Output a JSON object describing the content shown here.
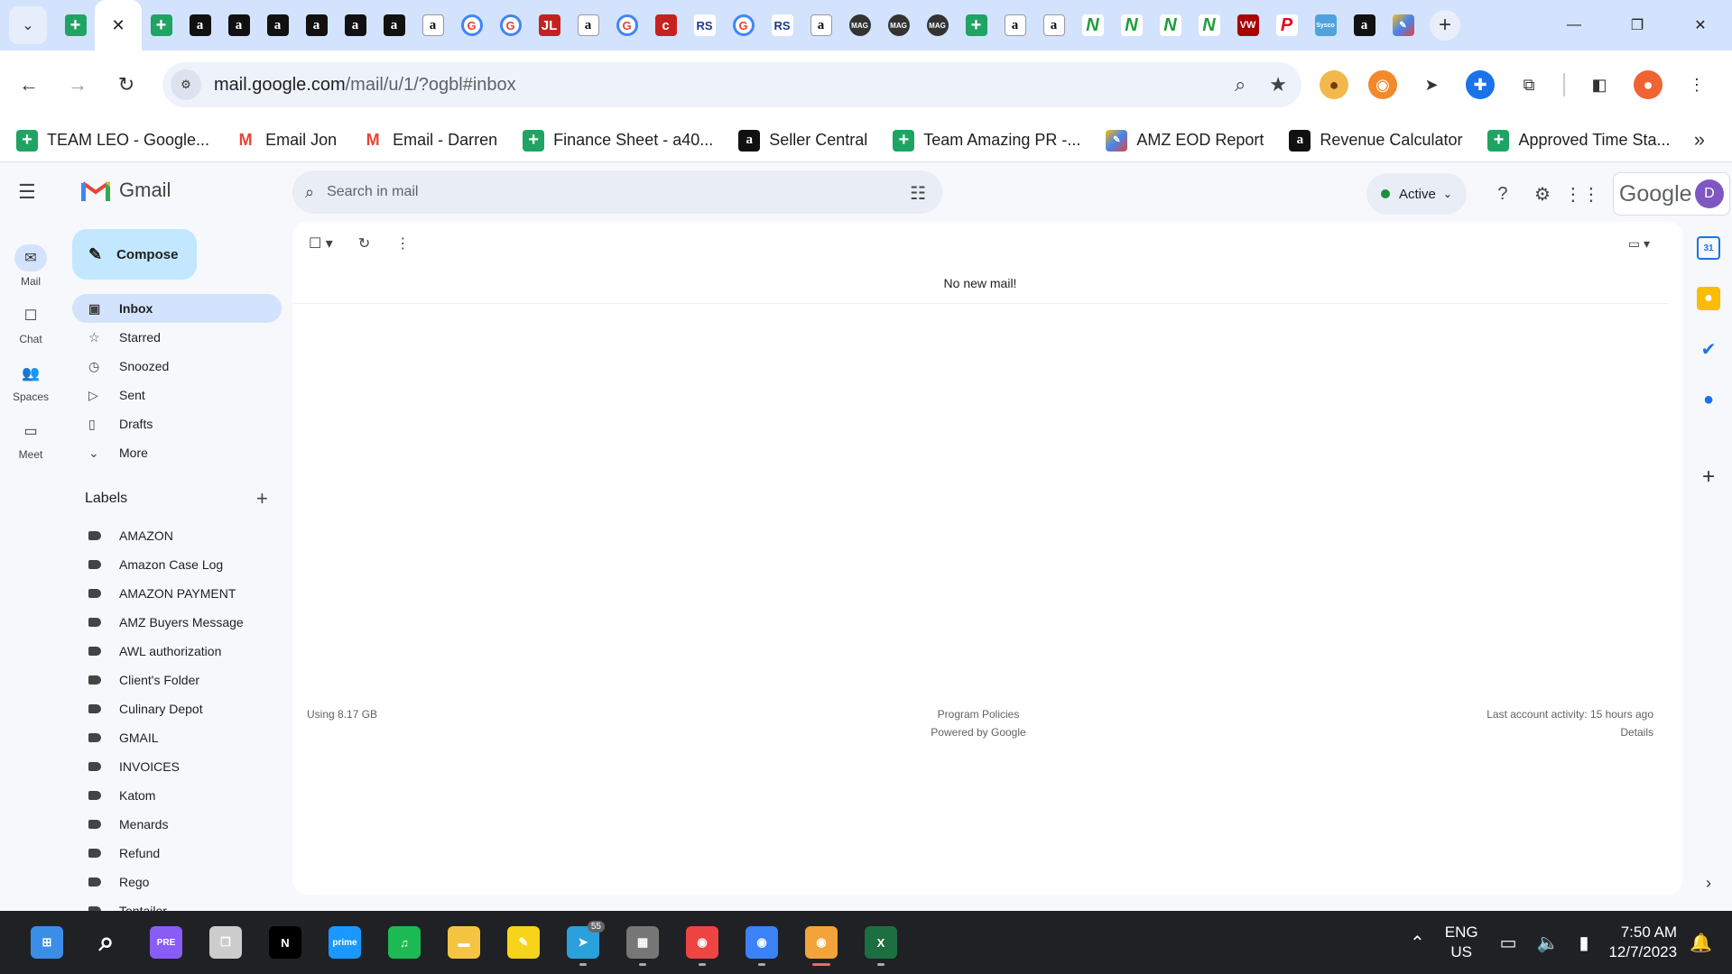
{
  "browser": {
    "tabs": [
      {
        "icon": "sheets-icon",
        "glyph": "+",
        "style": "sheets"
      },
      {
        "icon": "close-icon",
        "glyph": "✕",
        "style": "active"
      },
      {
        "icon": "sheets-icon",
        "glyph": "+",
        "style": "sheets"
      },
      {
        "icon": "amazon-icon",
        "glyph": "a",
        "style": "amz"
      },
      {
        "icon": "amazon-icon",
        "glyph": "a",
        "style": "amz"
      },
      {
        "icon": "amazon-icon",
        "glyph": "a",
        "style": "amz"
      },
      {
        "icon": "amazon-icon",
        "glyph": "a",
        "style": "amz"
      },
      {
        "icon": "amazon-icon",
        "glyph": "a",
        "style": "amz"
      },
      {
        "icon": "amazon-icon",
        "glyph": "a",
        "style": "amz"
      },
      {
        "icon": "amazon-icon",
        "glyph": "a",
        "style": "amzw"
      },
      {
        "icon": "google-icon",
        "glyph": "G",
        "style": "g"
      },
      {
        "icon": "google-icon",
        "glyph": "G",
        "style": "g"
      },
      {
        "icon": "jungle-icon",
        "glyph": "JL",
        "style": "red"
      },
      {
        "icon": "amazon-icon",
        "glyph": "a",
        "style": "amzw"
      },
      {
        "icon": "google-icon",
        "glyph": "G",
        "style": "g"
      },
      {
        "icon": "c-logo-icon",
        "glyph": "c",
        "style": "red"
      },
      {
        "icon": "rs-icon",
        "glyph": "RS",
        "style": "rs"
      },
      {
        "icon": "google-icon",
        "glyph": "G",
        "style": "g"
      },
      {
        "icon": "rs-icon",
        "glyph": "RS",
        "style": "rs"
      },
      {
        "icon": "amazon-icon",
        "glyph": "a",
        "style": "amzw"
      },
      {
        "icon": "mag-icon",
        "glyph": "MAG",
        "style": "mag"
      },
      {
        "icon": "mag-icon",
        "glyph": "MAG",
        "style": "mag"
      },
      {
        "icon": "mag-icon",
        "glyph": "MAG",
        "style": "mag"
      },
      {
        "icon": "sheets-icon",
        "glyph": "+",
        "style": "sheets"
      },
      {
        "icon": "amazon-icon",
        "glyph": "a",
        "style": "amzw"
      },
      {
        "icon": "amazon-icon",
        "glyph": "a",
        "style": "amzw"
      },
      {
        "icon": "n-logo-icon",
        "glyph": "N",
        "style": "n"
      },
      {
        "icon": "n-logo-icon",
        "glyph": "N",
        "style": "n"
      },
      {
        "icon": "n-logo-icon",
        "glyph": "N",
        "style": "n"
      },
      {
        "icon": "n-logo-icon",
        "glyph": "N",
        "style": "n"
      },
      {
        "icon": "vw-icon",
        "glyph": "VW",
        "style": "vw"
      },
      {
        "icon": "pinterest-icon",
        "glyph": "P",
        "style": "p"
      },
      {
        "icon": "sysco-icon",
        "glyph": "Sysco",
        "style": "sys"
      },
      {
        "icon": "amazon-icon",
        "glyph": "a",
        "style": "amz"
      },
      {
        "icon": "multicolor-icon",
        "glyph": "✎",
        "style": "mix"
      }
    ],
    "url_host": "mail.google.com",
    "url_path": "/mail/u/1/?ogbl#inbox",
    "bookmarks": [
      {
        "icon": "sheets-icon",
        "glyph": "+",
        "style": "sheets",
        "label": "TEAM LEO - Google..."
      },
      {
        "icon": "gmail-icon",
        "glyph": "M",
        "style": "gm",
        "label": "Email Jon"
      },
      {
        "icon": "gmail-icon",
        "glyph": "M",
        "style": "gm",
        "label": "Email - Darren"
      },
      {
        "icon": "sheets-icon",
        "glyph": "+",
        "style": "sheets",
        "label": "Finance Sheet - a40..."
      },
      {
        "icon": "amazon-icon",
        "glyph": "a",
        "style": "amz",
        "label": "Seller Central"
      },
      {
        "icon": "sheets-icon",
        "glyph": "+",
        "style": "sheets",
        "label": "Team Amazing PR -..."
      },
      {
        "icon": "multicolor-icon",
        "glyph": "✎",
        "style": "mix",
        "label": "AMZ EOD Report"
      },
      {
        "icon": "amazon-icon",
        "glyph": "a",
        "style": "amz",
        "label": "Revenue Calculator"
      },
      {
        "icon": "sheets-icon",
        "glyph": "+",
        "style": "sheets",
        "label": "Approved Time Sta..."
      }
    ]
  },
  "gmail": {
    "logo_text": "Gmail",
    "search_placeholder": "Search in mail",
    "status": "Active",
    "account_brand": "Google",
    "avatar_letter": "D",
    "compose": "Compose",
    "rail": [
      {
        "icon": "mail-icon",
        "glyph": "✉",
        "label": "Mail",
        "active": true
      },
      {
        "icon": "chat-icon",
        "glyph": "☐",
        "label": "Chat",
        "active": false
      },
      {
        "icon": "spaces-icon",
        "glyph": "👥",
        "label": "Spaces",
        "active": false
      },
      {
        "icon": "meet-icon",
        "glyph": "▭",
        "label": "Meet",
        "active": false
      }
    ],
    "nav": [
      {
        "icon": "inbox-icon",
        "glyph": "▣",
        "label": "Inbox",
        "active": true
      },
      {
        "icon": "star-icon",
        "glyph": "☆",
        "label": "Starred",
        "active": false
      },
      {
        "icon": "clock-icon",
        "glyph": "◷",
        "label": "Snoozed",
        "active": false
      },
      {
        "icon": "send-icon",
        "glyph": "▷",
        "label": "Sent",
        "active": false
      },
      {
        "icon": "draft-icon",
        "glyph": "▯",
        "label": "Drafts",
        "active": false
      },
      {
        "icon": "chevron-down-icon",
        "glyph": "⌄",
        "label": "More",
        "active": false
      }
    ],
    "labels_heading": "Labels",
    "labels": [
      "AMAZON",
      "Amazon Case Log",
      "AMAZON PAYMENT",
      "AMZ Buyers Message",
      "AWL authorization",
      "Client's Folder",
      "Culinary Depot",
      "GMAIL",
      "INVOICES",
      "Katom",
      "Menards",
      "Refund",
      "Rego",
      "Tentailer"
    ],
    "empty_message": "No new mail!",
    "footer": {
      "storage": "Using 8.17 GB",
      "policies": "Program Policies",
      "powered": "Powered by Google",
      "activity": "Last account activity: 15 hours ago",
      "details": "Details"
    }
  },
  "taskbar": {
    "apps": [
      {
        "icon": "windows-start-icon",
        "glyph": "⊞",
        "bg": "#3a8ee6"
      },
      {
        "icon": "search-icon",
        "glyph": "⌕",
        "bg": "transparent"
      },
      {
        "icon": "copilot-icon",
        "glyph": "PRE",
        "bg": "#8a5cf6"
      },
      {
        "icon": "task-view-icon",
        "glyph": "❐",
        "bg": "#ccc"
      },
      {
        "icon": "netflix-icon",
        "glyph": "N",
        "bg": "#000"
      },
      {
        "icon": "prime-video-icon",
        "glyph": "prime",
        "bg": "#1a98ff"
      },
      {
        "icon": "spotify-icon",
        "glyph": "♫",
        "bg": "#1db954"
      },
      {
        "icon": "file-explorer-icon",
        "glyph": "▬",
        "bg": "#f6c443"
      },
      {
        "icon": "sticky-notes-icon",
        "glyph": "✎",
        "bg": "#f7d31c"
      },
      {
        "icon": "telegram-icon",
        "glyph": "➤",
        "bg": "#2aa1da"
      },
      {
        "icon": "calculator-icon",
        "glyph": "▦",
        "bg": "#777"
      },
      {
        "icon": "chrome-icon",
        "glyph": "◉",
        "bg": "#e44"
      },
      {
        "icon": "chrome-icon",
        "glyph": "◉",
        "bg": "#3b82f6"
      },
      {
        "icon": "chrome-icon",
        "glyph": "◉",
        "bg": "#f2a33a"
      },
      {
        "icon": "excel-icon",
        "glyph": "X",
        "bg": "#1d6f42"
      }
    ],
    "telegram_badge": "55",
    "lang_top": "ENG",
    "lang_bottom": "US",
    "time": "7:50 AM",
    "date": "12/7/2023"
  }
}
